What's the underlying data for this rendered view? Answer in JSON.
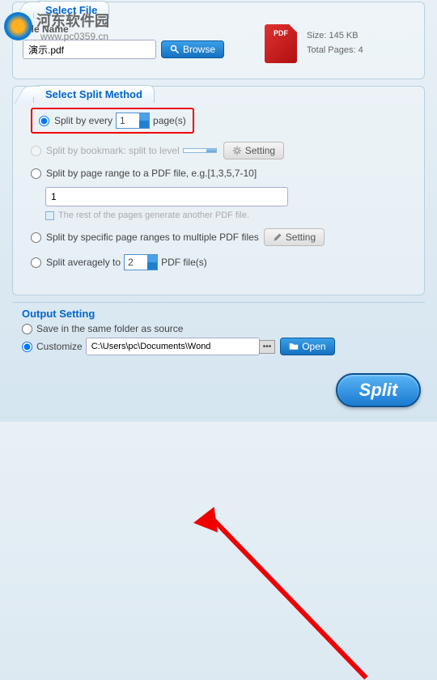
{
  "watermark": {
    "text": "河东软件园",
    "url": "www.pc0359.cn"
  },
  "selectFile": {
    "tab": "Select File",
    "fileNameLabel": "File Name",
    "fileName": "演示.pdf",
    "browse": "Browse",
    "sizeLabel": "Size: 145  KB",
    "pagesLabel": "Total Pages: 4"
  },
  "splitMethod": {
    "tab": "Select Split Method",
    "opt1_pre": "Split by every",
    "opt1_val": "1",
    "opt1_post": "page(s)",
    "opt2": "Split by bookmark: split to level",
    "opt2_setting": "Setting",
    "opt3": "Split by page range to a PDF file, e.g.[1,3,5,7-10]",
    "opt3_val": "1",
    "opt3_note": "The rest of the pages generate another PDF file.",
    "opt4": "Split by specific page ranges to multiple PDF files",
    "opt4_setting": "Setting",
    "opt5_pre": "Split averagely to",
    "opt5_val": "2",
    "opt5_post": "PDF file(s)"
  },
  "output": {
    "title": "Output Setting",
    "same": "Save in the same folder as source",
    "custom": "Customize",
    "path": "C:\\Users\\pc\\Documents\\Wond",
    "open": "Open"
  },
  "splitBtn": "Split"
}
